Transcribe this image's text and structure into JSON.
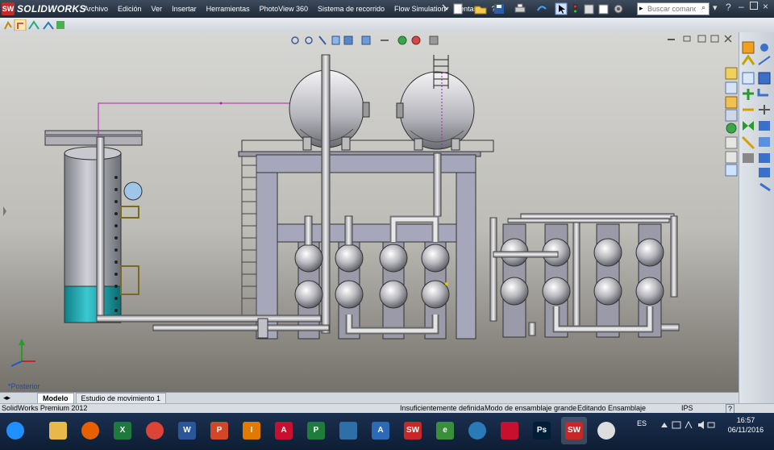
{
  "app": {
    "brand_letters": "SW",
    "brand_name": "SOLIDWORKS"
  },
  "menu": [
    "Archivo",
    "Edición",
    "Ver",
    "Insertar",
    "Herramientas",
    "PhotoView 360",
    "Sistema de recorrido",
    "Flow Simulation",
    "Ventana",
    "?"
  ],
  "search": {
    "placeholder": "Buscar comanc"
  },
  "viewport": {
    "view_label": "*Posterior"
  },
  "tabs": [
    {
      "label": "Modelo",
      "active": true
    },
    {
      "label": "Estudio de movimiento 1",
      "active": false
    }
  ],
  "status": {
    "product": "SolidWorks Premium 2012",
    "definition": "Insuficientemente definida",
    "mode": "Modo de ensamblaje grande",
    "editing": "Editando Ensamblaje",
    "units": "IPS",
    "help": "?"
  },
  "taskbar": {
    "language": "ES",
    "time": "16:57",
    "date": "06/11/2016",
    "apps": [
      {
        "icon": "windows-start-icon",
        "label": "",
        "color": "#1e90ff"
      },
      {
        "icon": "file-explorer-icon",
        "label": "",
        "color": "#e8b84a"
      },
      {
        "icon": "firefox-icon",
        "label": "",
        "color": "#e66000"
      },
      {
        "icon": "excel-icon",
        "label": "X",
        "color": "#1d7a3c"
      },
      {
        "icon": "chrome-icon",
        "label": "",
        "color": "#db4437"
      },
      {
        "icon": "word-icon",
        "label": "W",
        "color": "#2b579a"
      },
      {
        "icon": "powerpoint-icon",
        "label": "P",
        "color": "#d24726"
      },
      {
        "icon": "inventor-icon",
        "label": "I",
        "color": "#e07b00"
      },
      {
        "icon": "autocad-icon",
        "label": "A",
        "color": "#c8102e"
      },
      {
        "icon": "project-icon",
        "label": "P",
        "color": "#1e7d3a"
      },
      {
        "icon": "autodesk-app-icon",
        "label": "",
        "color": "#2e6fa8"
      },
      {
        "icon": "revit-icon",
        "label": "A",
        "color": "#2d6ab5"
      },
      {
        "icon": "solidworks-icon",
        "label": "SW",
        "color": "#c62828"
      },
      {
        "icon": "edrawings-icon",
        "label": "e",
        "color": "#3a8f3a"
      },
      {
        "icon": "update-icon",
        "label": "",
        "color": "#2a7ab8"
      },
      {
        "icon": "acrobat-icon",
        "label": "",
        "color": "#c8102e"
      },
      {
        "icon": "photoshop-icon",
        "label": "Ps",
        "color": "#001e36"
      },
      {
        "icon": "solidworks-active-icon",
        "label": "SW",
        "color": "#c62828"
      },
      {
        "icon": "paint-icon",
        "label": "",
        "color": "#ddd"
      }
    ]
  }
}
